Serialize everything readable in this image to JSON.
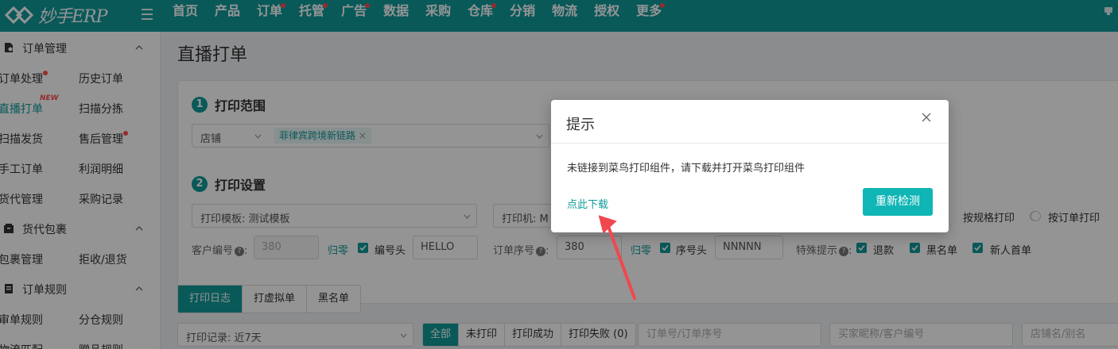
{
  "brand": {
    "name": "妙手ERP"
  },
  "nav": {
    "items": [
      {
        "label": "首页",
        "dot": false
      },
      {
        "label": "产品",
        "dot": false
      },
      {
        "label": "订单",
        "dot": true
      },
      {
        "label": "托管",
        "dot": true
      },
      {
        "label": "广告",
        "dot": true
      },
      {
        "label": "数据",
        "dot": false
      },
      {
        "label": "采购",
        "dot": false
      },
      {
        "label": "仓库",
        "dot": true
      },
      {
        "label": "分销",
        "dot": false
      },
      {
        "label": "物流",
        "dot": false
      },
      {
        "label": "授权",
        "dot": false
      },
      {
        "label": "更多",
        "dot": true
      }
    ]
  },
  "sidebar": {
    "groups": [
      {
        "title": "订单管理",
        "items": [
          "订单处理",
          "历史订单",
          "直播打单",
          "扫描分拣",
          "扫描发货",
          "售后管理",
          "手工订单",
          "利润明细",
          "货代管理",
          "采购记录"
        ]
      },
      {
        "title": "货代包裹",
        "items": [
          "包裹管理",
          "拒收/退货"
        ]
      },
      {
        "title": "订单规则",
        "items": [
          "审单规则",
          "分仓规则",
          "物流匹配",
          "赠品规则"
        ]
      }
    ],
    "new_badge": "NEW"
  },
  "page": {
    "title": "直播打单"
  },
  "scope": {
    "number": "1",
    "title": "打印范围",
    "store_label": "店铺",
    "store_tag": "菲律宾跨境新链路"
  },
  "settings": {
    "number": "2",
    "title": "打印设置",
    "template_label": "打印模板:",
    "template_value": "测试模板",
    "printer_label": "打印机:",
    "printer_value": "M",
    "radio_spec": "按规格打印",
    "radio_order": "按订单打印",
    "customer_no_label": "客户编号",
    "customer_no_value": "380",
    "reset_label": "归零",
    "prefix_label": "编号头",
    "prefix_value": "HELLO",
    "order_seq_label": "订单序号",
    "order_seq_value": "380",
    "order_reset_label": "归零",
    "seq_prefix_label": "序号头",
    "seq_prefix_value": "NNNNN",
    "special_label": "特殊提示",
    "refund_label": "退款",
    "blacklist_label": "黑名单",
    "new_customer_label": "新人首单"
  },
  "tabs": [
    "打印日志",
    "打虚拟单",
    "黑名单"
  ],
  "filters": {
    "record_label": "打印记录:",
    "record_value": "近7天",
    "segments": [
      "全部",
      "未打印",
      "打印成功",
      "打印失败 (0)"
    ],
    "order_placeholder": "订单号/订单序号",
    "buyer_placeholder": "买家昵称/客户编号",
    "store_placeholder": "店铺名/别名"
  },
  "dialog": {
    "title": "提示",
    "message": "未链接到菜鸟打印组件，请下载并打开菜鸟打印组件",
    "download_link": "点此下载",
    "recheck_button": "重新检测"
  },
  "colors": {
    "brand": "#10999a",
    "button": "#10b5b5",
    "alert_dot": "#ff4d4f",
    "annotation_arrow": "#f0484e"
  }
}
